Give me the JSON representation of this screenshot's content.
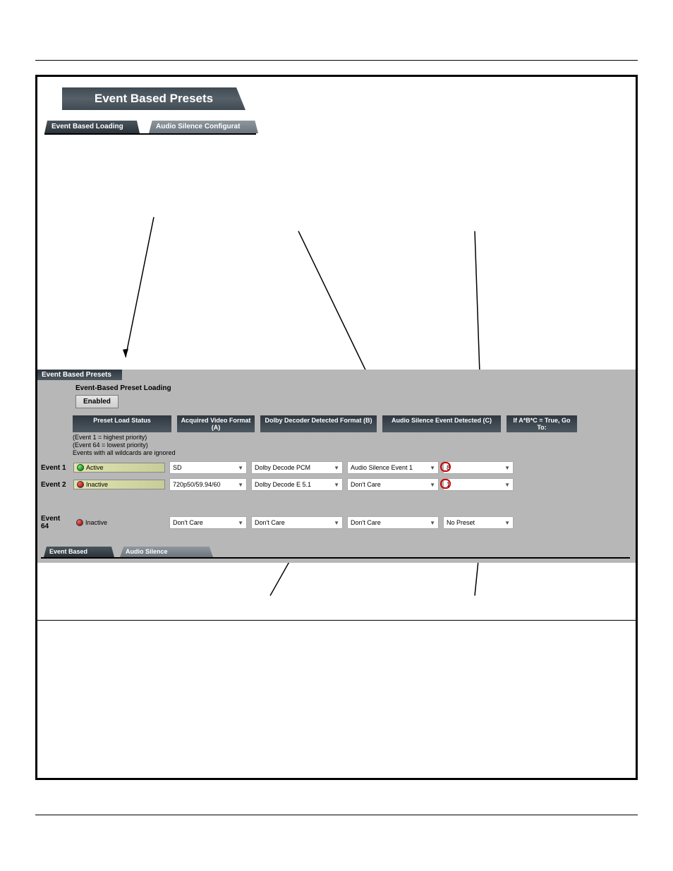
{
  "title": "Event Based Presets",
  "tabs": {
    "active": "Event Based Loading",
    "inactive": "Audio Silence Configurat"
  },
  "panel": {
    "head": "Event Based Presets",
    "ebpl": "Event-Based Preset Loading",
    "enabled": "Enabled",
    "headers": {
      "pls": "Preset Load Status",
      "a": "Acquired Video Format (A)",
      "b": "Dolby Decoder Detected Format (B)",
      "c": "Audio Silence Event Detected (C)",
      "go": "If A*B*C = True, Go To:"
    },
    "notes": [
      "(Event 1 = highest priority)",
      "(Event 64 = lowest priority)",
      "Events with all wildcards are ignored"
    ],
    "rows": [
      {
        "label": "Event 1",
        "led": "green",
        "status": "Active",
        "a": "SD",
        "b": "Dolby Decode PCM",
        "c": "Audio Silence Event 1",
        "go": "8"
      },
      {
        "label": "Event 2",
        "led": "red",
        "status": "Inactive",
        "a": "720p50/59.94/60",
        "b": "Dolby Decode E 5.1",
        "c": "Don't Care",
        "go": "1"
      },
      {
        "label": "Event 64",
        "led": "red",
        "status": "Inactive",
        "a": "Don't Care",
        "b": "Don't Care",
        "c": "Don't Care",
        "go": "No Preset"
      }
    ]
  },
  "tabs2": {
    "active": "Event Based Loading",
    "inactive": "Audio Silence Configuration"
  }
}
